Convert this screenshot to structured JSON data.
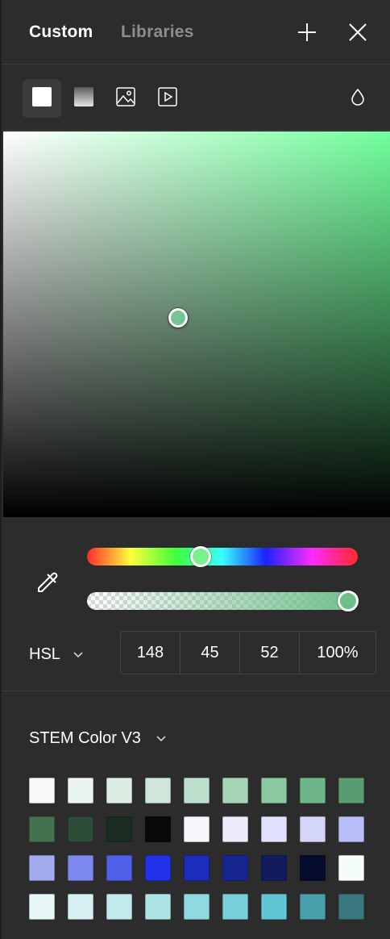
{
  "header": {
    "tabs": [
      {
        "label": "Custom",
        "active": true
      },
      {
        "label": "Libraries",
        "active": false
      }
    ],
    "add_icon": "plus-icon",
    "close_icon": "close-icon"
  },
  "fill_types": [
    {
      "icon": "solid-fill-icon",
      "active": true
    },
    {
      "icon": "gradient-fill-icon",
      "active": false
    },
    {
      "icon": "image-fill-icon",
      "active": false
    },
    {
      "icon": "video-fill-icon",
      "active": false
    }
  ],
  "blend_icon": "blend-mode-drop-icon",
  "color": {
    "mode": "HSL",
    "values": [
      "148",
      "45",
      "52",
      "100%"
    ],
    "hue": 148,
    "saturation": 45,
    "lightness": 52,
    "alpha": 1.0,
    "current_hex": "#5fc28a"
  },
  "library": {
    "name": "STEM Color V3",
    "swatches": [
      "#f7f9f8",
      "#eaf4ee",
      "#dcece3",
      "#cfe6da",
      "#bde0cc",
      "#a6d4b7",
      "#8cc9a2",
      "#6db687",
      "#5a9b70",
      "#43724f",
      "#2d4c37",
      "#1a2b1f",
      "#080a09",
      "#f6f7fd",
      "#ececfb",
      "#e0e1fd",
      "#d5d7f9",
      "#b8bdf5",
      "#a3abef",
      "#7b88ee",
      "#4f5fe8",
      "#2132e9",
      "#1c2dbb",
      "#17258f",
      "#101c5c",
      "#070d2d",
      "#f4fcfb",
      "#e7f6f6",
      "#d8f0f3",
      "#c2e9ec",
      "#aee3e6",
      "#91d9e1",
      "#79cfdb",
      "#5fc4d4",
      "#4a9fac",
      "#3a7880"
    ]
  }
}
